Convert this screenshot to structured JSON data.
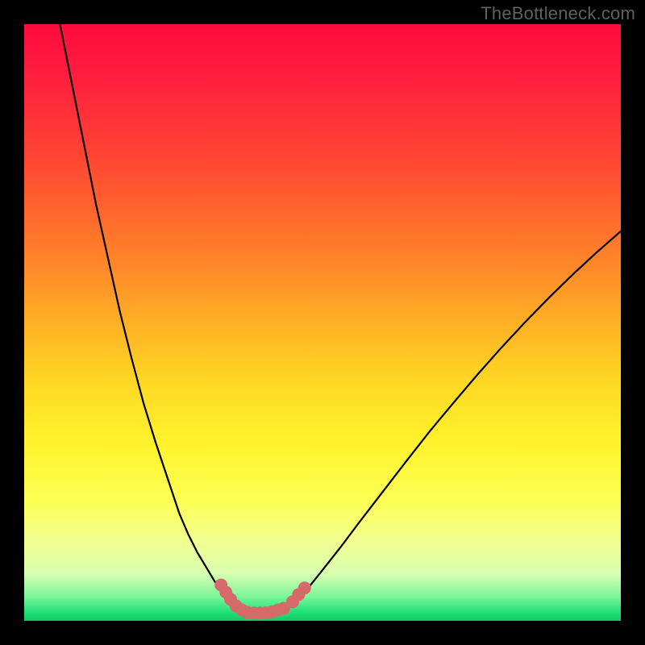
{
  "watermark": {
    "text": "TheBottleneck.com"
  },
  "colors": {
    "frame": "#000000",
    "curve": "#000000",
    "marker": "#d66a6a",
    "gradient_top": "#ff0a3c",
    "gradient_mid": "#fff22c",
    "gradient_bottom": "#11c864"
  },
  "chart_data": {
    "type": "line",
    "title": "",
    "xlabel": "",
    "ylabel": "",
    "xlim": [
      0,
      100
    ],
    "ylim": [
      0,
      100
    ],
    "series": [
      {
        "name": "left-curve",
        "x": [
          6,
          8,
          10,
          12,
          14,
          16,
          18,
          20,
          22,
          24,
          26,
          27.5,
          29,
          30.5,
          32,
          33,
          34,
          35
        ],
        "y": [
          100,
          90,
          80,
          70,
          61,
          52,
          44,
          36.5,
          30,
          24,
          18,
          14.5,
          11.5,
          9,
          6.5,
          4.8,
          3.3,
          2
        ]
      },
      {
        "name": "floor",
        "x": [
          35,
          36,
          37,
          38,
          39,
          40,
          41,
          42,
          43,
          44
        ],
        "y": [
          2,
          1.4,
          1.1,
          1.0,
          1.0,
          1.0,
          1.1,
          1.3,
          1.6,
          2
        ]
      },
      {
        "name": "right-curve",
        "x": [
          44,
          46,
          48,
          50,
          53,
          56,
          60,
          64,
          68,
          72,
          76,
          80,
          84,
          88,
          92,
          96,
          100
        ],
        "y": [
          2,
          3.8,
          6,
          8.5,
          12.3,
          16.3,
          21.5,
          26.7,
          31.8,
          36.6,
          41.3,
          45.8,
          50.1,
          54.2,
          58.1,
          61.8,
          65.3
        ]
      }
    ],
    "markers": [
      {
        "name": "left-cluster",
        "x": 33.0,
        "y": 6.0
      },
      {
        "name": "left-cluster",
        "x": 33.8,
        "y": 4.8
      },
      {
        "name": "left-cluster",
        "x": 34.6,
        "y": 3.6
      },
      {
        "name": "left-cluster",
        "x": 35.5,
        "y": 2.5
      },
      {
        "name": "left-cluster",
        "x": 36.5,
        "y": 1.8
      },
      {
        "name": "floor-cluster",
        "x": 37.5,
        "y": 1.4
      },
      {
        "name": "floor-cluster",
        "x": 38.5,
        "y": 1.3
      },
      {
        "name": "floor-cluster",
        "x": 39.5,
        "y": 1.3
      },
      {
        "name": "floor-cluster",
        "x": 40.5,
        "y": 1.35
      },
      {
        "name": "floor-cluster",
        "x": 41.5,
        "y": 1.5
      },
      {
        "name": "floor-cluster",
        "x": 42.5,
        "y": 1.8
      },
      {
        "name": "floor-cluster",
        "x": 43.5,
        "y": 2.1
      },
      {
        "name": "right-cluster",
        "x": 45.0,
        "y": 3.2
      },
      {
        "name": "right-cluster",
        "x": 46.0,
        "y": 4.4
      },
      {
        "name": "right-cluster",
        "x": 47.0,
        "y": 5.5
      }
    ]
  }
}
